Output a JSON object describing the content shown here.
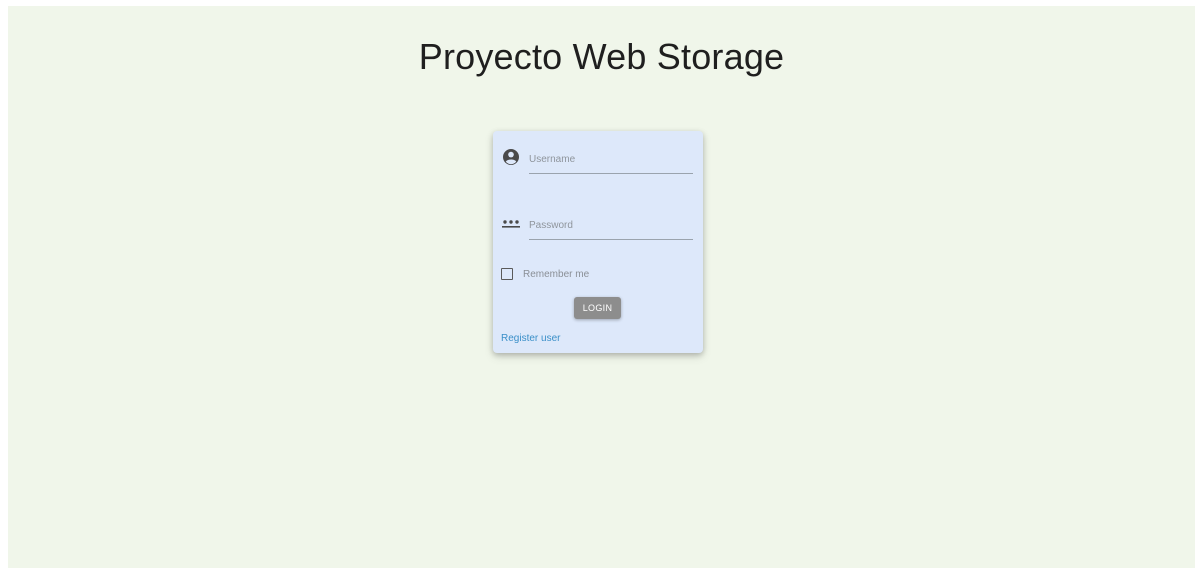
{
  "header": {
    "title": "Proyecto Web Storage"
  },
  "login_form": {
    "username": {
      "icon": "account-circle-icon",
      "placeholder": "Username",
      "value": ""
    },
    "password": {
      "icon": "password-dots-icon",
      "placeholder": "Password",
      "value": ""
    },
    "remember_me": {
      "label": "Remember me",
      "checked": false
    },
    "login_button_label": "LOGIN",
    "register_link_label": "Register user"
  },
  "colors": {
    "page_background": "#f0f6ea",
    "card_background": "#dde8fa",
    "button_background": "#8d8d8d",
    "link_color": "#3a8fc8"
  }
}
